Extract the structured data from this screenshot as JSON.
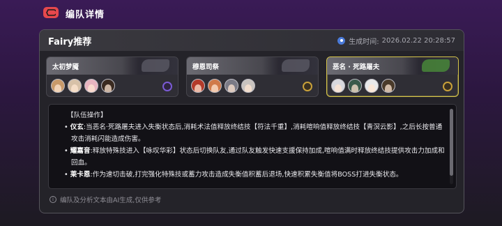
{
  "header": {
    "title": "编队详情"
  },
  "panel": {
    "title": "Fairy推荐",
    "generated_label": "生成时间:",
    "generated_time": "2026.02.22 20:28:57"
  },
  "teams": [
    {
      "name": "太初梦魇",
      "avatars": [
        "#c89a6a",
        "#d7c1a8",
        "#e8b4c0",
        "#3a2a20"
      ],
      "badge": "purple"
    },
    {
      "name": "穆恩司祭",
      "avatars": [
        "#b33a2a",
        "#d07a4a",
        "#7a7a86",
        "#c9c3bf"
      ],
      "badge": "gold"
    },
    {
      "name": "恶名 · 死路屠夫",
      "avatars": [
        "#d8d8de",
        "#3a5a4a",
        "#e8e8ea",
        "#4a3a2a"
      ],
      "badge": "gold"
    }
  ],
  "notes": {
    "heading": "【队伍操作】",
    "bullets": [
      {
        "name": "仪玄",
        "text": ":当恶名·死路屠夫进入失衡状态后,消耗术法值释放终结技【符法千重】,消耗喧响值释放终结技【青溟云影】,之后长按普通攻击消耗闪能造成伤害。"
      },
      {
        "name": "耀嘉音",
        "text": ":释放特殊技进入【咏叹华彩】状态后切换队友,通过队友触发快速支援保持加成,喧响值满时释放终结技提供攻击力加成和回血。"
      },
      {
        "name": "莱卡恩",
        "text": ":作为速切击破,打完强化特殊技或蓄力攻击造成失衡值积蓄后退场,快速积累失衡值将BOSS打进失衡状态。"
      }
    ]
  },
  "footer": {
    "info_icon": "i",
    "text": "编队及分析文本由AI生成,仅供参考"
  }
}
